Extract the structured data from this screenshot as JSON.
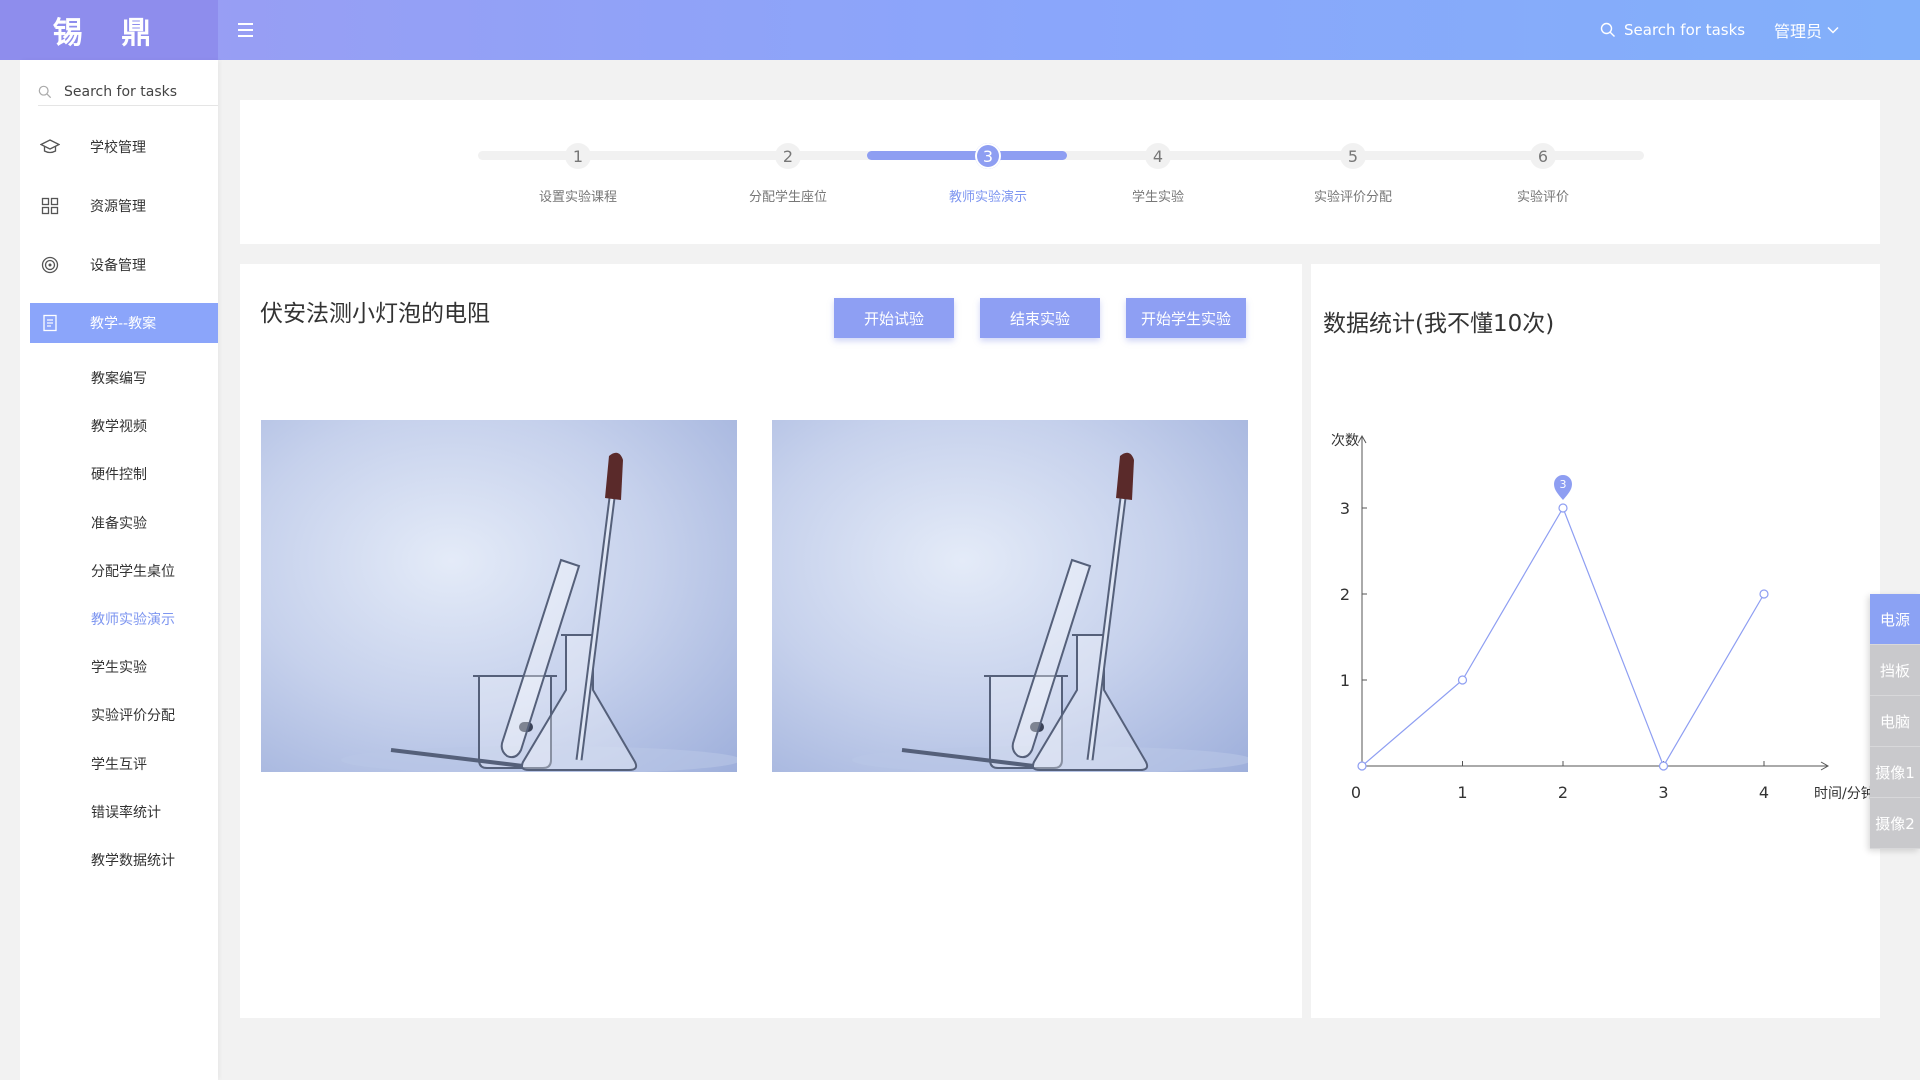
{
  "app": {
    "logo": "锡 鼎"
  },
  "header": {
    "search_placeholder": "Search for tasks",
    "user_label": "管理员"
  },
  "sidebar": {
    "search_placeholder": "Search for tasks",
    "items": [
      {
        "label": "学校管理",
        "icon": "graduation-cap-icon"
      },
      {
        "label": "资源管理",
        "icon": "grid-icon"
      },
      {
        "label": "设备管理",
        "icon": "target-icon"
      },
      {
        "label": "教学--教案",
        "icon": "document-icon",
        "active": true
      }
    ],
    "sub_items": [
      {
        "label": "教案编写"
      },
      {
        "label": "教学视频"
      },
      {
        "label": "硬件控制"
      },
      {
        "label": "准备实验"
      },
      {
        "label": "分配学生桌位"
      },
      {
        "label": "教师实验演示",
        "active": true
      },
      {
        "label": "学生实验"
      },
      {
        "label": "实验评价分配"
      },
      {
        "label": "学生互评"
      },
      {
        "label": "错误率统计"
      },
      {
        "label": "教学数据统计"
      }
    ]
  },
  "steps": {
    "current": 3,
    "items": [
      {
        "num": "1",
        "label": "设置实验课程"
      },
      {
        "num": "2",
        "label": "分配学生座位"
      },
      {
        "num": "3",
        "label": "教师实验演示"
      },
      {
        "num": "4",
        "label": "学生实验"
      },
      {
        "num": "5",
        "label": "实验评价分配"
      },
      {
        "num": "6",
        "label": "实验评价"
      }
    ]
  },
  "experiment": {
    "title": "伏安法测小灯泡的电阻",
    "buttons": {
      "start_trial": "开始试验",
      "end_experiment": "结束实验",
      "start_student": "开始学生实验"
    }
  },
  "stats": {
    "title": "数据统计(我不懂10次)"
  },
  "chart_data": {
    "type": "line",
    "title": "数据统计(我不懂10次)",
    "xlabel": "时间/分钟",
    "ylabel": "次数",
    "x": [
      0,
      1,
      2,
      3,
      4
    ],
    "y": [
      0,
      1,
      3,
      0,
      2
    ],
    "x_ticks": [
      "0",
      "1",
      "2",
      "3",
      "4"
    ],
    "y_ticks": [
      "1",
      "2",
      "3"
    ],
    "ylim": [
      0,
      3
    ],
    "annotations": [
      {
        "x": 2,
        "y": 3,
        "text": "3"
      }
    ],
    "series_color": "#8e9ef2",
    "grid": false
  },
  "float_panel": {
    "items": [
      {
        "label": "电源",
        "active": true
      },
      {
        "label": "挡板"
      },
      {
        "label": "电脑"
      },
      {
        "label": "摄像1"
      },
      {
        "label": "摄像2"
      }
    ]
  },
  "colors": {
    "accent": "#8e9ef2",
    "header_start": "#9b9cf2",
    "header_end": "#82b0fa",
    "active_text": "#7e96f0"
  }
}
